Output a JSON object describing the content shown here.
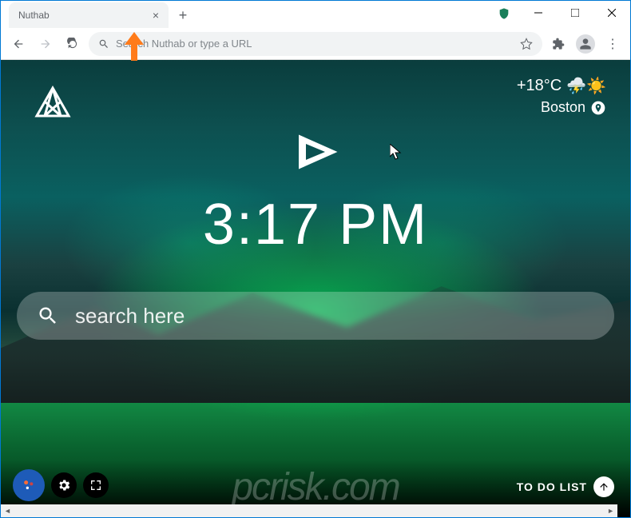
{
  "tab": {
    "title": "Nuthab"
  },
  "addressbar": {
    "placeholder": "Search Nuthab or type a URL"
  },
  "weather": {
    "temp": "+18°C",
    "location": "Boston"
  },
  "clock": {
    "time": "3:17 PM"
  },
  "search": {
    "placeholder": "search here"
  },
  "todo": {
    "label": "TO DO LIST"
  },
  "watermark": "pcrisk.com"
}
